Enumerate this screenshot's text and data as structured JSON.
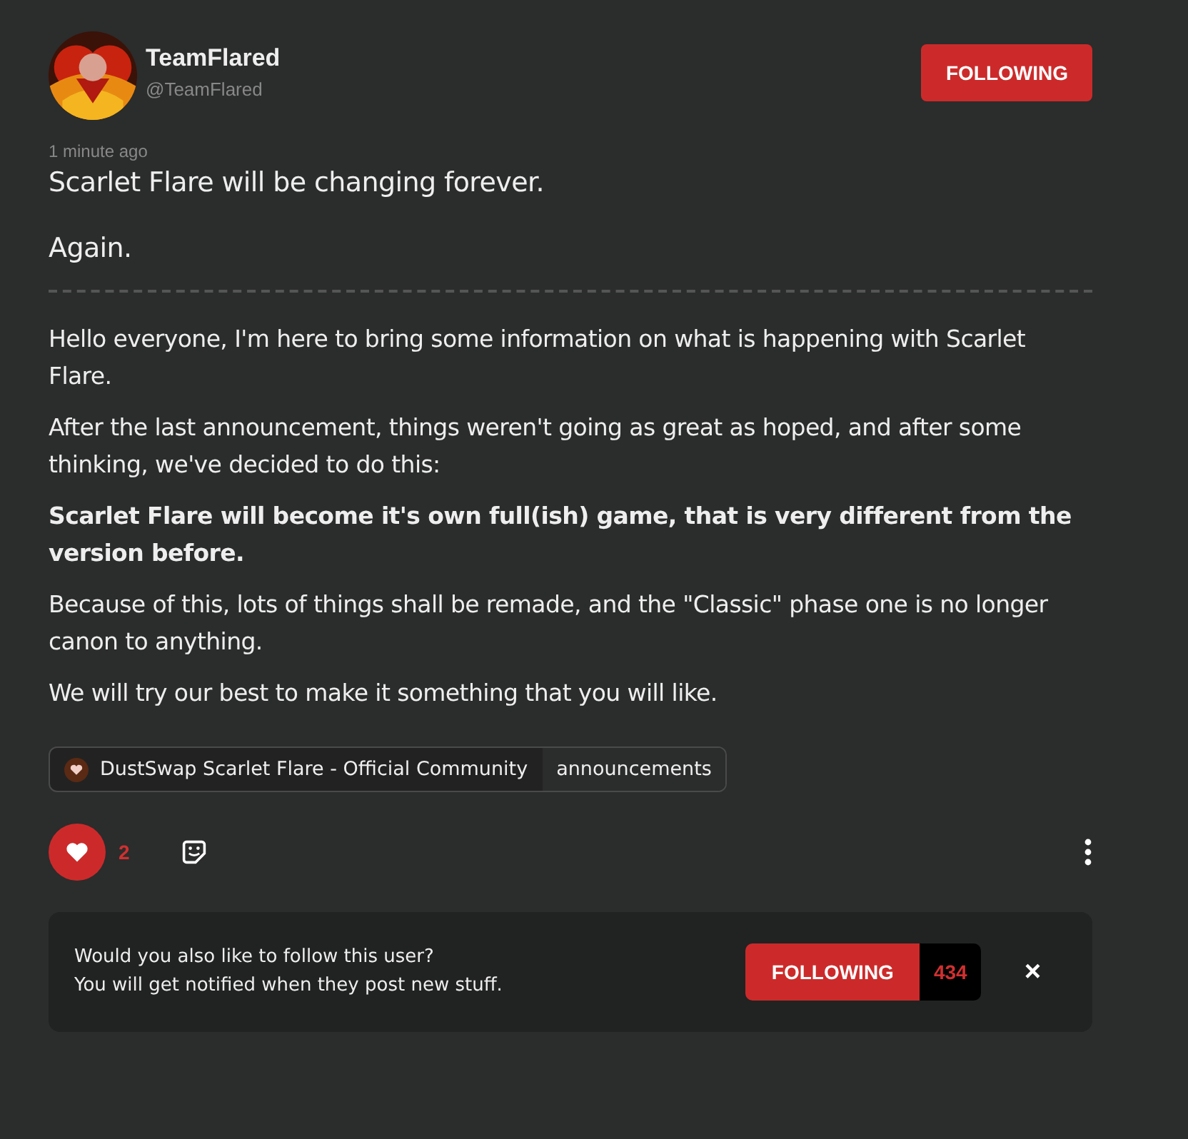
{
  "author": {
    "name": "TeamFlared",
    "handle": "@TeamFlared",
    "following": true,
    "follow_label": "FOLLOWING"
  },
  "post": {
    "time": "1 minute ago",
    "title": "Scarlet Flare will be changing forever.",
    "subtitle": "Again.",
    "paragraphs": [
      {
        "text": "Hello everyone, I'm here to bring some information on what is happening with Scarlet Flare.",
        "bold": false
      },
      {
        "text": "After the last announcement, things weren't going as great as hoped, and after some thinking, we've decided to do this:",
        "bold": false
      },
      {
        "text": "Scarlet Flare will become it's own full(ish) game, that is very different from the version before.",
        "bold": true
      },
      {
        "text": "Because of this, lots of things shall be remade, and the \"Classic\" phase one is no longer canon to anything.",
        "bold": false
      },
      {
        "text": "We will try our best to make it something that you will like.",
        "bold": false
      }
    ],
    "community": {
      "name": "DustSwap Scarlet Flare - Official Community",
      "channel": "announcements"
    },
    "likes": {
      "liked": true,
      "count": "2"
    }
  },
  "follow_prompt": {
    "lines": [
      "Would you also like to follow this user?",
      "You will get notified when they post new stuff."
    ],
    "button": "FOLLOWING",
    "following": true,
    "count": "434",
    "close": "×"
  }
}
